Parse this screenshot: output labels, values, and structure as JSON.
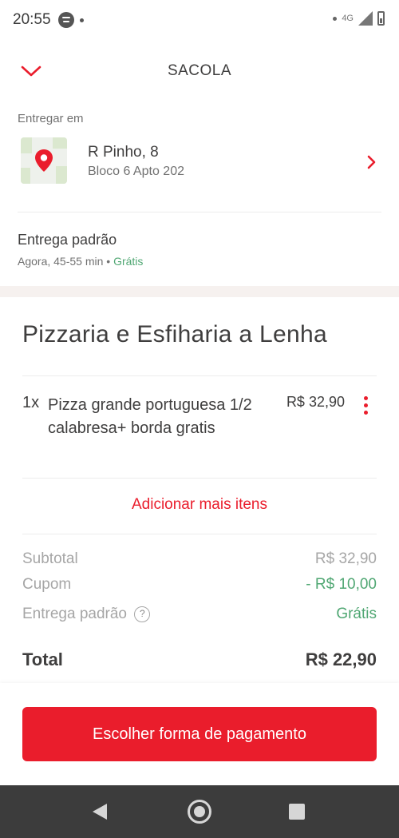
{
  "status_bar": {
    "time": "20:55",
    "network": "4G"
  },
  "header": {
    "title": "SACOLA"
  },
  "delivery": {
    "label": "Entregar em",
    "address_main": "R Pinho, 8",
    "address_sub": "Bloco 6 Apto 202",
    "type": "Entrega padrão",
    "time": "Agora, 45-55 min •",
    "free": "Grátis"
  },
  "store": {
    "name": "Pizzaria e Esfiharia a Lenha"
  },
  "items": [
    {
      "qty": "1x",
      "name": "Pizza grande portuguesa 1/2 calabresa+ borda gratis",
      "price": "R$  32,90"
    }
  ],
  "add_more": "Adicionar mais itens",
  "summary": {
    "subtotal_label": "Subtotal",
    "subtotal_value": "R$  32,90",
    "coupon_label": "Cupom",
    "coupon_value": "- R$  10,00",
    "delivery_label": "Entrega padrão",
    "delivery_value": "Grátis",
    "help_glyph": "?",
    "total_label": "Total",
    "total_value": "R$  22,90"
  },
  "payment_button": "Escolher forma de pagamento",
  "colors": {
    "accent": "#ea1d2c",
    "green": "#50a773",
    "section_bg": "#f6f1ef"
  },
  "icons": [
    "chevron-down-icon",
    "location-pin-icon",
    "chevron-right-icon",
    "kebab-menu-icon",
    "help-icon",
    "nav-back-icon",
    "nav-home-icon",
    "nav-recent-icon"
  ]
}
